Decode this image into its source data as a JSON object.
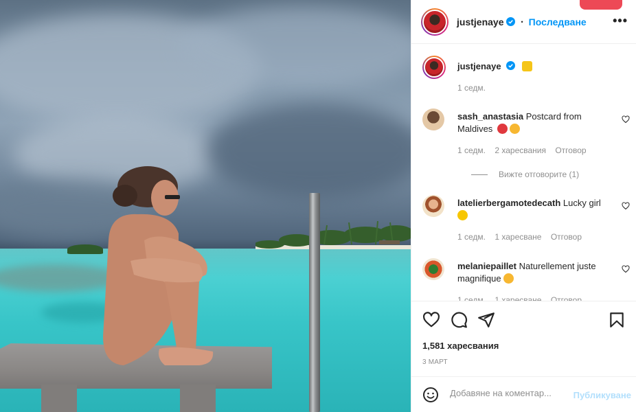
{
  "header": {
    "username": "justjenaye",
    "separator": "•",
    "follow_label": "Последване",
    "more_label": "•••"
  },
  "caption": {
    "username": "justjenaye",
    "time": "1 седм."
  },
  "comments": [
    {
      "username": "sash_anastasia",
      "text": "Postcard from Maldives",
      "time": "1 седм.",
      "likes": "2 харесвания",
      "reply_label": "Отговор",
      "view_replies": "Вижте отговорите (1)"
    },
    {
      "username": "latelierbergamotedecath",
      "text": "Lucky girl",
      "time": "1 седм.",
      "likes": "1 харесване",
      "reply_label": "Отговор"
    },
    {
      "username": "melaniepaillet",
      "text": "Naturellement juste magnifique",
      "time": "1 седм.",
      "likes": "1 харесване",
      "reply_label": "Отговор"
    }
  ],
  "stats": {
    "likes": "1,581 харесвания",
    "date": "3 МАРТ"
  },
  "composer": {
    "placeholder": "Добавяне на коментар...",
    "post_label": "Публикуване"
  },
  "colors": {
    "accent": "#0095f6",
    "post_disabled": "#b2dffc",
    "secondary_text": "#8e8e8e",
    "notification": "#ed4956"
  },
  "icons": [
    "verified-badge-icon",
    "more-options-icon",
    "heart-icon",
    "comment-icon",
    "share-icon",
    "bookmark-icon",
    "emoji-icon"
  ]
}
